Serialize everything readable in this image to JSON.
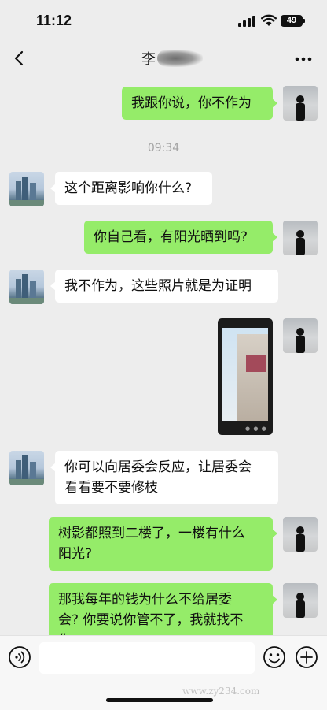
{
  "status": {
    "time": "11:12",
    "battery": "49"
  },
  "nav": {
    "title": "李"
  },
  "messages": {
    "m1": "我跟你说，你不作为",
    "timestamp": "09:34",
    "m2": "这个距离影响你什么?",
    "m3": "你自己看，有阳光晒到吗?",
    "m4": "我不作为，这些照片就是为证明",
    "m5_line1": "你可以向居委会反应，让居委会",
    "m5_line2": "看看要不要修枝",
    "m6_line1": "树影都照到二楼了，一楼有什么",
    "m6_line2": "阳光?",
    "m7_line1": "那我每年的钱为什么不给居委",
    "m7_line2": "会? 你要说你管不了，我就找不",
    "m7_line3": "你"
  },
  "icons": {
    "back": "chevron-left-icon",
    "more": "more-dots-icon",
    "voice": "voice-icon",
    "emoji": "emoji-icon",
    "plus": "plus-icon"
  },
  "colors": {
    "self_bubble": "#95ec69",
    "other_bubble": "#ffffff",
    "background": "#ededed"
  },
  "watermark": "www.zy234.com"
}
